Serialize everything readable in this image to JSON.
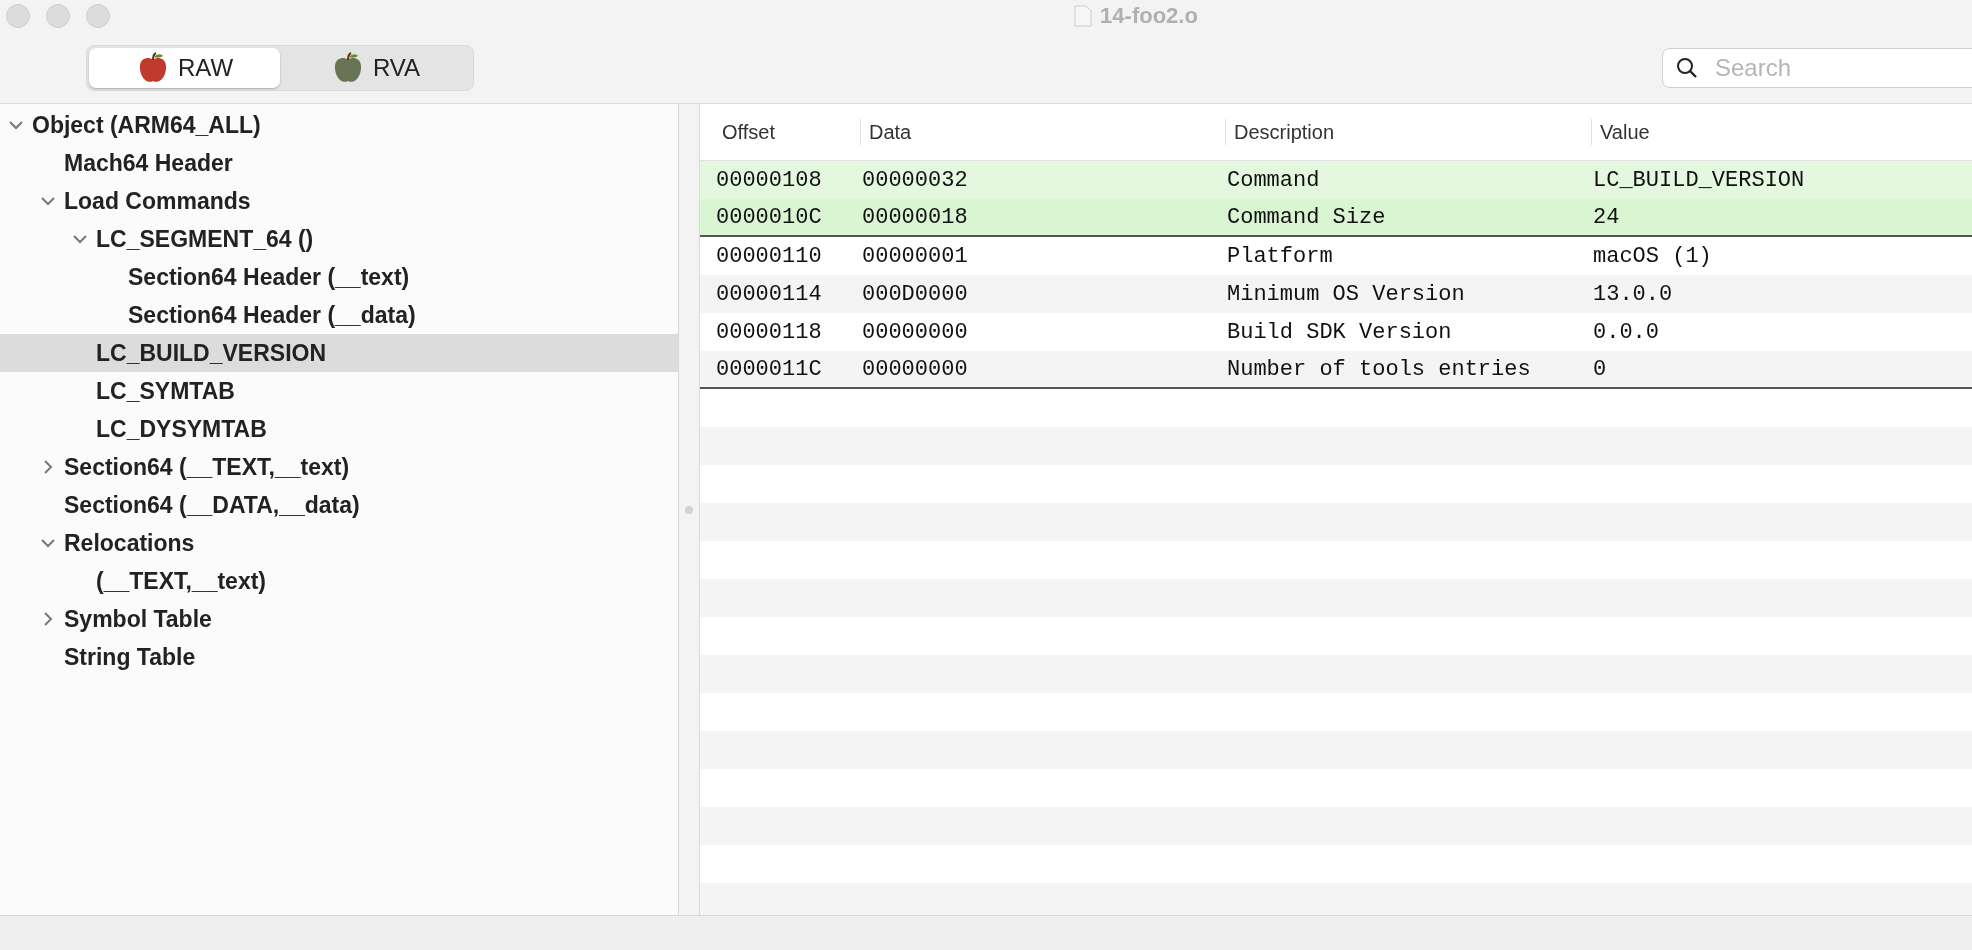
{
  "window": {
    "title": "14-foo2.o"
  },
  "mode_tabs": [
    {
      "label": "RAW",
      "selected": true,
      "color": "#c0392b"
    },
    {
      "label": "RVA",
      "selected": false,
      "color": "#6b7356"
    }
  ],
  "search": {
    "placeholder": "Search"
  },
  "tree": [
    {
      "label": "Object  (ARM64_ALL)",
      "expanded": true,
      "selected": false,
      "children": [
        {
          "label": "Mach64 Header",
          "selected": false
        },
        {
          "label": "Load Commands",
          "expanded": true,
          "selected": false,
          "children": [
            {
              "label": "LC_SEGMENT_64 ()",
              "expanded": true,
              "selected": false,
              "children": [
                {
                  "label": "Section64 Header (__text)",
                  "selected": false
                },
                {
                  "label": "Section64 Header (__data)",
                  "selected": false
                }
              ]
            },
            {
              "label": "LC_BUILD_VERSION",
              "selected": true
            },
            {
              "label": "LC_SYMTAB",
              "selected": false
            },
            {
              "label": "LC_DYSYMTAB",
              "selected": false
            }
          ]
        },
        {
          "label": "Section64 (__TEXT,__text)",
          "expanded": false,
          "selected": false
        },
        {
          "label": "Section64 (__DATA,__data)",
          "selected": false
        },
        {
          "label": "Relocations",
          "expanded": true,
          "selected": false,
          "children": [
            {
              "label": "(__TEXT,__text)",
              "selected": false
            }
          ]
        },
        {
          "label": "Symbol Table",
          "expanded": false,
          "selected": false
        },
        {
          "label": "String Table",
          "selected": false
        }
      ]
    }
  ],
  "table": {
    "columns": [
      "Offset",
      "Data",
      "Description",
      "Value"
    ],
    "rows": [
      {
        "cells": [
          "00000108",
          "00000032",
          "Command",
          "LC_BUILD_VERSION"
        ],
        "highlighted": true
      },
      {
        "cells": [
          "0000010C",
          "00000018",
          "Command Size",
          "24"
        ],
        "highlighted": true
      },
      {
        "cells": [
          "00000110",
          "00000001",
          "Platform",
          "macOS (1)"
        ],
        "highlighted": false
      },
      {
        "cells": [
          "00000114",
          "000D0000",
          "Minimum OS Version",
          "13.0.0"
        ],
        "highlighted": false
      },
      {
        "cells": [
          "00000118",
          "00000000",
          "Build SDK Version",
          "0.0.0"
        ],
        "highlighted": false
      },
      {
        "cells": [
          "0000011C",
          "00000000",
          "Number of tools entries",
          "0"
        ],
        "highlighted": false
      }
    ]
  }
}
